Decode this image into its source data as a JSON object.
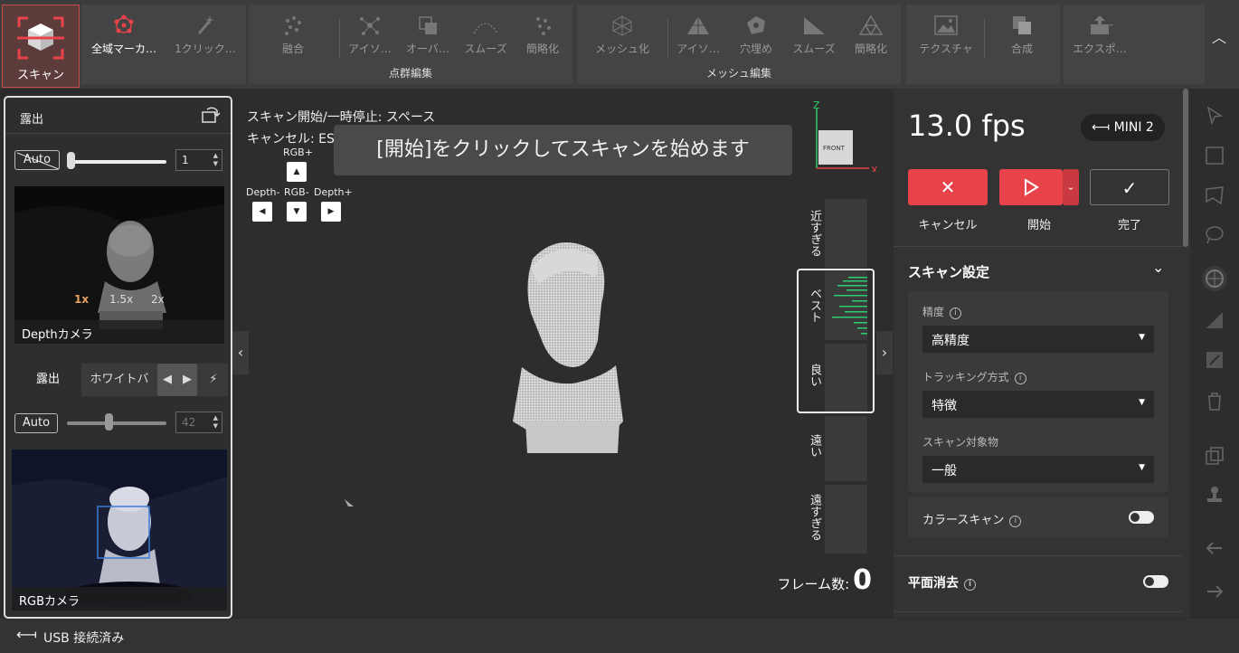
{
  "toolbar": {
    "scan": "スキャン",
    "global_marker": "全域マーカ…",
    "one_click": "1クリック…",
    "pc_fuse": "融合",
    "pc_iso": "アイソ…",
    "pc_overlap": "オーバ…",
    "pc_smooth": "スムーズ",
    "pc_simplify": "簡略化",
    "point_cloud_edit": "点群編集",
    "mesh": "メッシュ化",
    "mesh_iso": "アイソ…",
    "mesh_fill": "穴埋め",
    "mesh_smooth": "スムーズ",
    "mesh_simplify": "簡略化",
    "mesh_edit": "メッシュ編集",
    "texture": "テクスチャ",
    "merge": "合成",
    "export": "エクスポ…"
  },
  "left_panel": {
    "exposure_title": "露出",
    "depth_auto": "Auto",
    "depth_value": "1",
    "zoom_1x": "1x",
    "zoom_15x": "1.5x",
    "zoom_2x": "2x",
    "depth_camera": "Depthカメラ",
    "tab_exposure": "露出",
    "tab_white_balance": "ホワイトバ",
    "rgb_auto": "Auto",
    "rgb_value": "42",
    "rgb_camera": "RGBカメラ"
  },
  "viewport": {
    "hint_start": "スキャン開始/一時停止:  スペース",
    "hint_cancel": "キャンセル:  ES",
    "banner": "[開始]をクリックしてスキャンを始めます",
    "rgb_plus": "RGB+",
    "rgb_minus": "RGB-",
    "depth_minus": "Depth-",
    "depth_plus": "Depth+",
    "axis_z": "Z",
    "axis_x": "X",
    "cube_front": "FRONT",
    "q_too_close": "近すぎる",
    "q_best": "ベスト",
    "q_good": "良い",
    "q_far": "遠い",
    "q_too_far": "遠すぎる",
    "frames_label": "フレーム数:",
    "frames_value": "0"
  },
  "right_panel": {
    "fps": "13.0 fps",
    "device": "MINI 2",
    "cancel": "キャンセル",
    "start": "開始",
    "done": "完了",
    "scan_settings": "スキャン設定",
    "precision_label": "精度",
    "precision_value": "高精度",
    "tracking_label": "トラッキング方式",
    "tracking_value": "特徴",
    "object_label": "スキャン対象物",
    "object_value": "一般",
    "color_scan": "カラースキャン",
    "plane_removal": "平面消去"
  },
  "status": {
    "usb": "USB 接続済み"
  },
  "colors": {
    "accent_red": "#e8434a",
    "quality_green": "#2ecc71"
  }
}
